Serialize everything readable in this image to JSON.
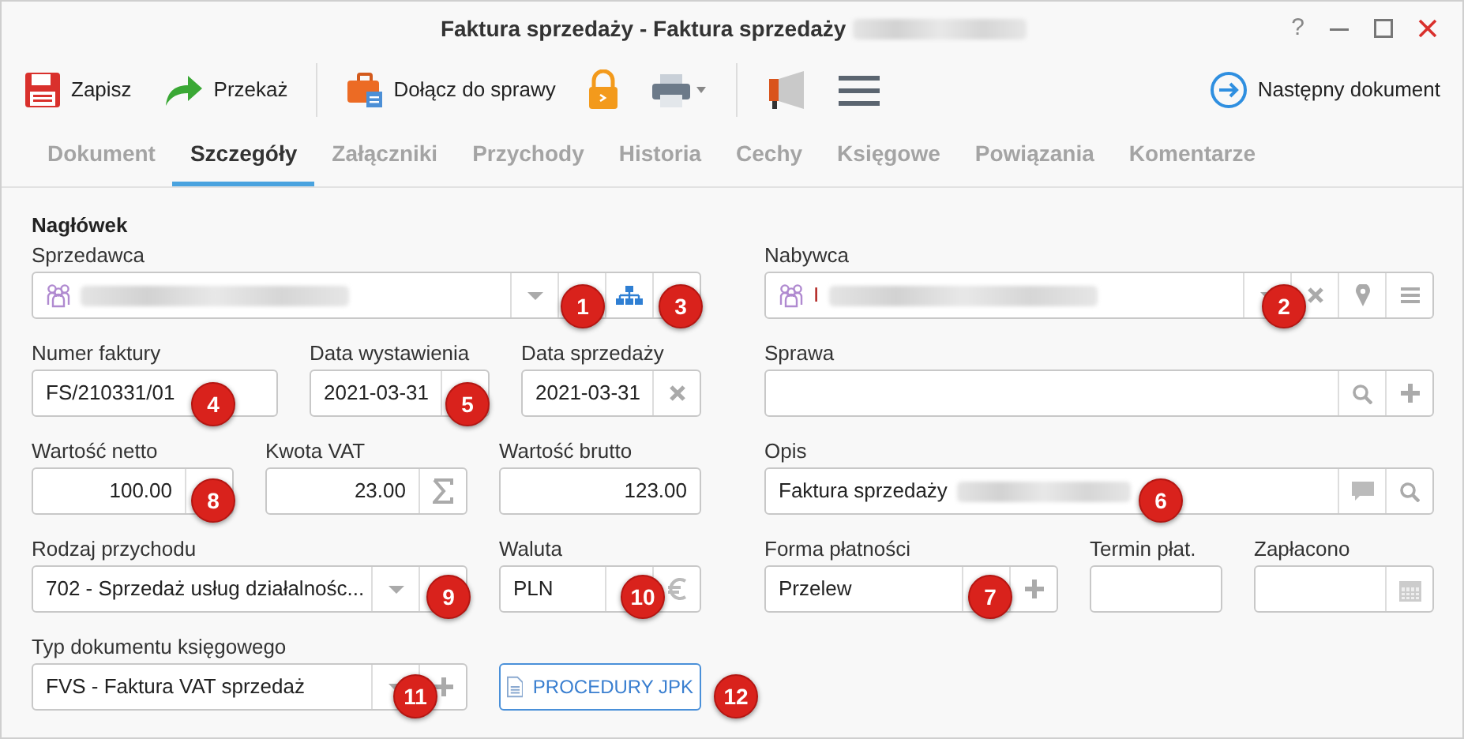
{
  "window": {
    "title": "Faktura sprzedaży - Faktura sprzedaży",
    "title_blurred": true,
    "controls": [
      "?"
    ]
  },
  "toolbar": [
    {
      "kind": "save",
      "label": "Zapisz"
    },
    {
      "kind": "forward",
      "label": "Przekaż"
    },
    {
      "kind": "separator"
    },
    {
      "kind": "case",
      "label": "Dołącz do sprawy"
    },
    {
      "kind": "lock"
    },
    {
      "kind": "print"
    },
    {
      "kind": "separator"
    },
    {
      "kind": "megaphone"
    },
    {
      "kind": "menu"
    }
  ],
  "next_button": {
    "label": "Następny dokument"
  },
  "tabs": [
    {
      "label": "Dokument",
      "selected": false
    },
    {
      "label": "Szczegóły",
      "selected": true
    },
    {
      "label": "Załączniki",
      "selected": false
    },
    {
      "label": "Przychody",
      "selected": false
    },
    {
      "label": "Historia",
      "selected": false
    },
    {
      "label": "Cechy",
      "selected": false
    },
    {
      "label": "Księgowe",
      "selected": false
    },
    {
      "label": "Powiązania",
      "selected": false
    },
    {
      "label": "Komentarze",
      "selected": false
    }
  ],
  "section_title": "Nagłówek",
  "left_rows": [
    [
      {
        "kind": "contact",
        "label": "Sprzedawca",
        "blurred": true,
        "addons": [
          {
            "kind": "caret"
          },
          {
            "kind": "blank"
          },
          {
            "kind": "sitemap"
          },
          {
            "kind": "blank"
          }
        ]
      }
    ],
    [
      {
        "kind": "text",
        "label": "Numer faktury",
        "value": "FS/210331/01"
      },
      {
        "kind": "text",
        "label": "Data wystawienia",
        "value": "2021-03-31",
        "addons": [
          {
            "kind": "blank"
          }
        ]
      },
      {
        "kind": "text",
        "label": "Data sprzedaży",
        "value": "2021-03-31",
        "addons": [
          {
            "kind": "clear"
          }
        ]
      }
    ],
    [
      {
        "kind": "amount",
        "label": "Wartość netto",
        "value": "100.00",
        "addons": [
          {
            "kind": "blank"
          }
        ]
      },
      {
        "kind": "amount",
        "label": "Kwota VAT",
        "value": "23.00",
        "addons": [
          {
            "kind": "sigma"
          }
        ]
      },
      {
        "kind": "amount",
        "label": "Wartość brutto",
        "value": "123.00"
      }
    ],
    [
      {
        "kind": "text",
        "label": "Rodzaj przychodu",
        "value": "702 - Sprzedaż usług działalnośc...",
        "addons": [
          {
            "kind": "caret"
          },
          {
            "kind": "blank"
          }
        ]
      },
      {
        "kind": "text",
        "label": "Waluta",
        "value": "PLN",
        "addons": [
          {
            "kind": "blank"
          },
          {
            "kind": "euro"
          }
        ]
      }
    ],
    [
      {
        "kind": "text",
        "label": "Typ dokumentu księgowego",
        "value": "FVS - Faktura VAT sprzedaż",
        "addons": [
          {
            "kind": "caret"
          },
          {
            "kind": "plus"
          }
        ]
      },
      {
        "kind": "button",
        "label": "PROCEDURY JPK"
      }
    ]
  ],
  "right_rows": [
    [
      {
        "kind": "contact",
        "label": "Nabywca",
        "value": "I",
        "blurred": true,
        "addons": [
          {
            "kind": "caret"
          },
          {
            "kind": "clear"
          },
          {
            "kind": "pin"
          },
          {
            "kind": "menu"
          }
        ]
      }
    ],
    [
      {
        "kind": "text",
        "label": "Sprawa",
        "addons": [
          {
            "kind": "search"
          },
          {
            "kind": "plus"
          }
        ]
      }
    ],
    [
      {
        "kind": "text",
        "label": "Opis",
        "value": "Faktura sprzedaży",
        "blurred": true,
        "addons": [
          {
            "kind": "comment"
          },
          {
            "kind": "search"
          }
        ]
      }
    ],
    [
      {
        "kind": "text",
        "label": "Forma płatności",
        "value": "Przelew",
        "addons": [
          {
            "kind": "blank"
          },
          {
            "kind": "plus"
          }
        ]
      },
      {
        "kind": "text",
        "label": "Termin płat."
      },
      {
        "kind": "text",
        "label": "Zapłacono",
        "addons": [
          {
            "kind": "calendar"
          }
        ]
      }
    ]
  ],
  "annotation_badges": [
    "1",
    "3",
    "2",
    "4",
    "5",
    "8",
    "6",
    "9",
    "10",
    "7",
    "11",
    "12"
  ]
}
